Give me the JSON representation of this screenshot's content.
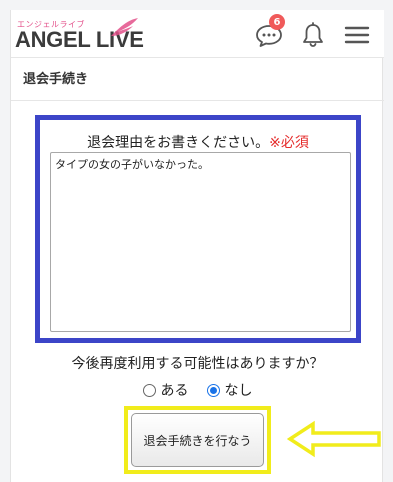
{
  "header": {
    "logo_kana": "エンジェルライブ",
    "logo_text": "ANGEL LIVE",
    "chat_badge": "6",
    "icons": [
      "chat-icon",
      "bell-icon",
      "menu-icon"
    ]
  },
  "section": {
    "title": "退会手続き"
  },
  "reason": {
    "label": "退会理由をお書きください。",
    "required": "※必須",
    "value": "タイプの女の子がいなかった。"
  },
  "reuse": {
    "question": "今後再度利用する可能性はありますか？",
    "options": [
      {
        "label": "ある",
        "checked": false
      },
      {
        "label": "なし",
        "checked": true
      }
    ]
  },
  "submit": {
    "label": "退会手続きを行なう"
  },
  "colors": {
    "highlight_blue": "#3c45c8",
    "highlight_yellow": "#f1ec1b",
    "required_red": "#e52b2b",
    "badge_red": "#f05a5a",
    "logo_pink": "#e3508a"
  }
}
